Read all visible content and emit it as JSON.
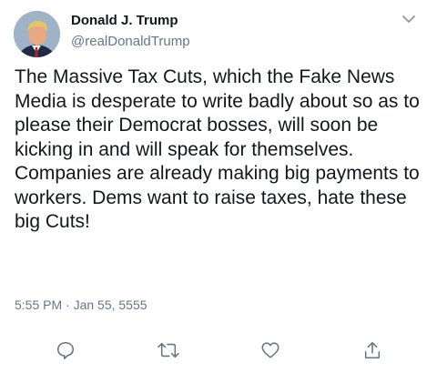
{
  "user": {
    "name": "Donald J. Trump",
    "handle": "@realDonaldTrump"
  },
  "tweet": {
    "text": "The Massive Tax Cuts, which the Fake News Media is desperate to write badly about so as to please their Democrat bosses, will soon be kicking in and will speak for themselves. Companies are already making big payments to workers. Dems want to raise taxes, hate these big Cuts!",
    "timestamp": "5:55 PM · Jan 55, 5555"
  },
  "icons": {
    "menu": "chevron-down-icon",
    "reply": "reply-icon",
    "retweet": "retweet-icon",
    "like": "heart-icon",
    "share": "share-icon"
  },
  "colors": {
    "text": "#14171a",
    "secondary": "#657786",
    "icon": "#657786",
    "background": "#ffffff"
  }
}
